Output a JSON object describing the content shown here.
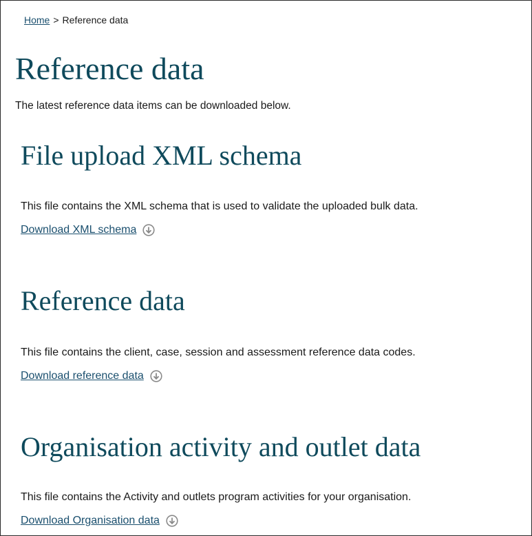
{
  "breadcrumb": {
    "home_label": "Home",
    "separator": ">",
    "current_label": "Reference data"
  },
  "page": {
    "title": "Reference data",
    "intro": "The latest reference data items can be downloaded below."
  },
  "sections": [
    {
      "title": "File upload XML schema",
      "description": "This file contains the XML schema that is used to validate the uploaded bulk data.",
      "download_label": "Download XML schema",
      "icon": "download-circle-icon"
    },
    {
      "title": "Reference data",
      "description": "This file contains the client, case, session and assessment reference data codes.",
      "download_label": "Download reference data",
      "icon": "download-circle-icon"
    },
    {
      "title": "Organisation activity and outlet data",
      "description": "This file contains the Activity and outlets program activities for your organisation.",
      "download_label": "Download Organisation data",
      "icon": "download-circle-icon"
    }
  ],
  "colors": {
    "heading": "#0f4a5c",
    "link": "#1a4f6e",
    "text": "#1a1a1a",
    "icon": "#8a8a8a"
  }
}
